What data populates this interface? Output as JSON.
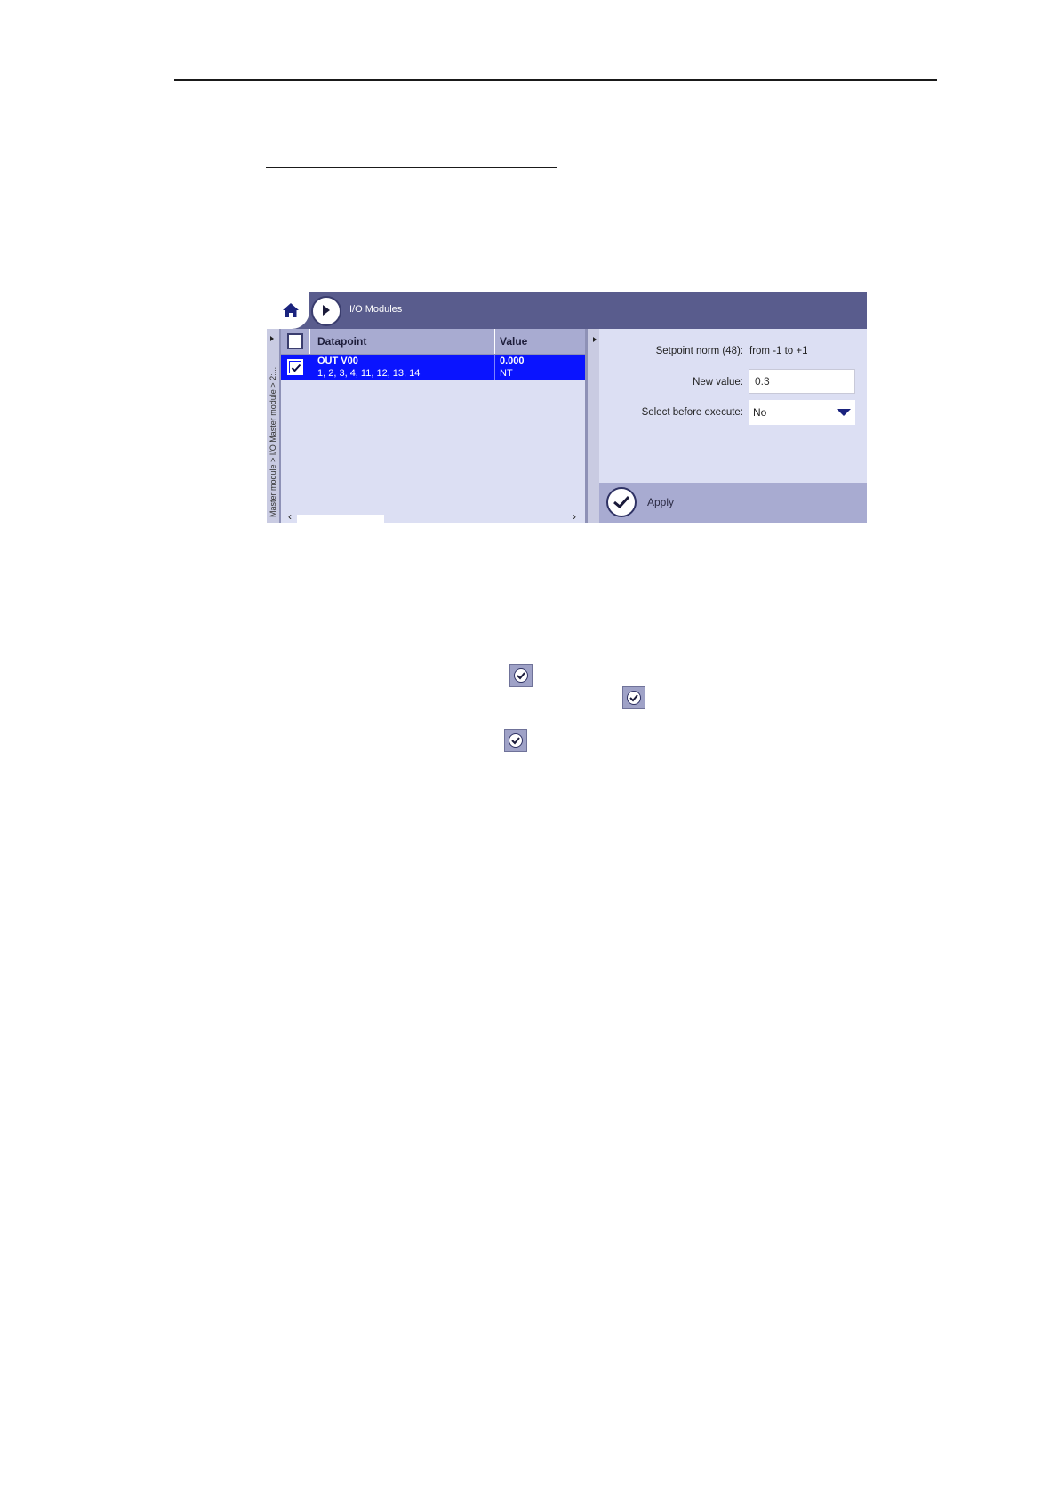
{
  "header_bar": {
    "title": "I/O Modules"
  },
  "breadcrumb": {
    "text": "Master module > I/O Master module > 2:..."
  },
  "table": {
    "columns": [
      "Datapoint",
      "Value"
    ],
    "rows": [
      {
        "name": "OUT V00",
        "sub": "1, 2, 3, 4, 11, 12, 13, 14",
        "value": "0.000",
        "quality": "NT",
        "checked": true
      }
    ]
  },
  "form": {
    "setpoint_label": "Setpoint norm (48):",
    "setpoint_value": "from -1 to +1",
    "new_value_label": "New value:",
    "new_value": "0.3",
    "sbe_label": "Select before execute:",
    "sbe_value": "No"
  },
  "apply": {
    "label": "Apply"
  },
  "colors": {
    "topbar": "#595c8d",
    "selected_row": "#0a14ff",
    "panel": "#dcdff3"
  }
}
